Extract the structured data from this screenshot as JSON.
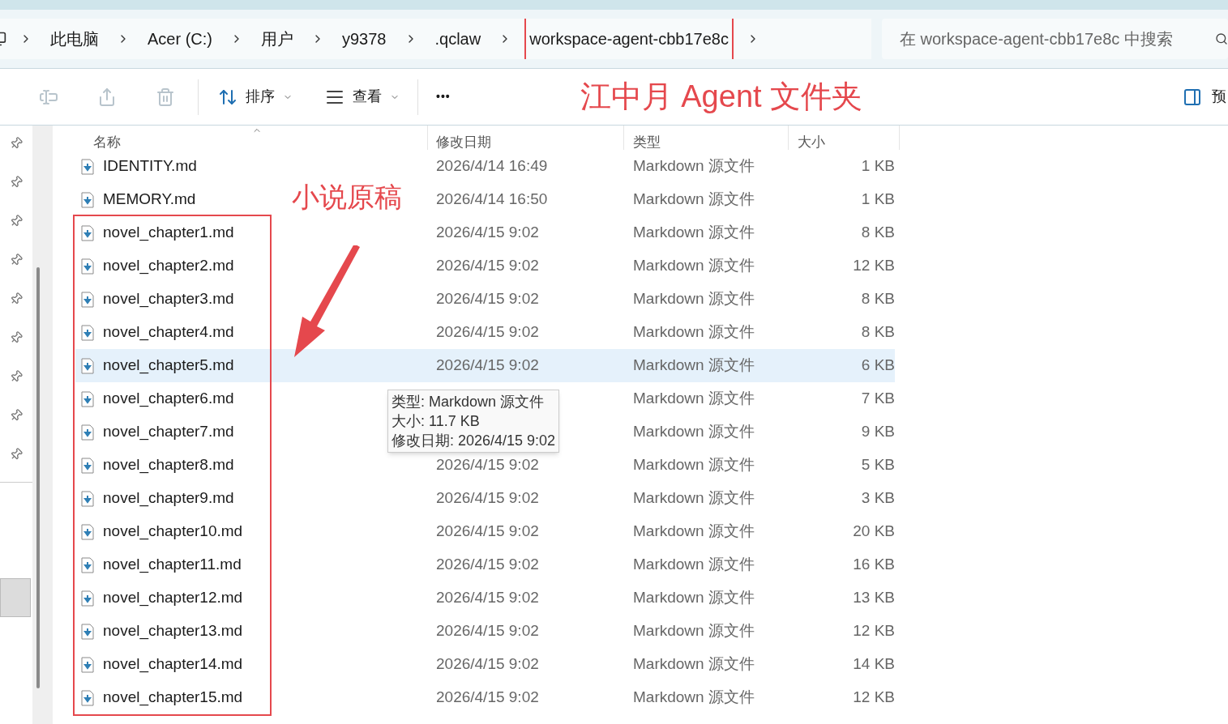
{
  "breadcrumb": {
    "items": [
      {
        "label": "此电脑",
        "selected": false
      },
      {
        "label": "Acer (C:)",
        "selected": false
      },
      {
        "label": "用户",
        "selected": false
      },
      {
        "label": "y9378",
        "selected": false
      },
      {
        "label": ".qclaw",
        "selected": false
      },
      {
        "label": "workspace-agent-cbb17e8c",
        "selected": true
      }
    ]
  },
  "search": {
    "placeholder": "在 workspace-agent-cbb17e8c 中搜索"
  },
  "toolbar": {
    "sort": "排序",
    "view": "查看",
    "more": "•••",
    "preview": "预"
  },
  "annotations": {
    "folder_label": "江中月 Agent 文件夹",
    "drafts_label": "小说原稿"
  },
  "table": {
    "columns": [
      "名称",
      "修改日期",
      "类型",
      "大小"
    ],
    "rows": [
      {
        "name": "IDENTITY.md",
        "date": "2026/4/14 16:49",
        "type": "Markdown 源文件",
        "size": "1 KB",
        "selected": false
      },
      {
        "name": "MEMORY.md",
        "date": "2026/4/14 16:50",
        "type": "Markdown 源文件",
        "size": "1 KB",
        "selected": false
      }
    ],
    "framed_rows": [
      {
        "name": "novel_chapter1.md",
        "date": "2026/4/15 9:02",
        "type": "Markdown 源文件",
        "size": "8 KB",
        "selected": false
      },
      {
        "name": "novel_chapter2.md",
        "date": "2026/4/15 9:02",
        "type": "Markdown 源文件",
        "size": "12 KB",
        "selected": false
      },
      {
        "name": "novel_chapter3.md",
        "date": "2026/4/15 9:02",
        "type": "Markdown 源文件",
        "size": "8 KB",
        "selected": false
      },
      {
        "name": "novel_chapter4.md",
        "date": "2026/4/15 9:02",
        "type": "Markdown 源文件",
        "size": "8 KB",
        "selected": false
      },
      {
        "name": "novel_chapter5.md",
        "date": "2026/4/15 9:02",
        "type": "Markdown 源文件",
        "size": "6 KB",
        "selected": true
      },
      {
        "name": "novel_chapter6.md",
        "type": "Markdown 源文件",
        "size": "7 KB",
        "selected": false
      },
      {
        "name": "novel_chapter7.md",
        "type": "Markdown 源文件",
        "size": "9 KB",
        "selected": false
      },
      {
        "name": "novel_chapter8.md",
        "date": "2026/4/15 9:02",
        "type": "Markdown 源文件",
        "size": "5 KB",
        "selected": false
      },
      {
        "name": "novel_chapter9.md",
        "date": "2026/4/15 9:02",
        "type": "Markdown 源文件",
        "size": "3 KB",
        "selected": false
      },
      {
        "name": "novel_chapter10.md",
        "date": "2026/4/15 9:02",
        "type": "Markdown 源文件",
        "size": "20 KB",
        "selected": false
      },
      {
        "name": "novel_chapter11.md",
        "date": "2026/4/15 9:02",
        "type": "Markdown 源文件",
        "size": "16 KB",
        "selected": false
      },
      {
        "name": "novel_chapter12.md",
        "date": "2026/4/15 9:02",
        "type": "Markdown 源文件",
        "size": "13 KB",
        "selected": false
      },
      {
        "name": "novel_chapter13.md",
        "date": "2026/4/15 9:02",
        "type": "Markdown 源文件",
        "size": "12 KB",
        "selected": false
      },
      {
        "name": "novel_chapter14.md",
        "date": "2026/4/15 9:02",
        "type": "Markdown 源文件",
        "size": "14 KB",
        "selected": false
      },
      {
        "name": "novel_chapter15.md",
        "date": "2026/4/15 9:02",
        "type": "Markdown 源文件",
        "size": "12 KB",
        "selected": false
      }
    ]
  },
  "tooltip": {
    "lines": [
      "类型: Markdown 源文件",
      "大小: 11.7 KB",
      "修改日期: 2026/4/15 9:02"
    ]
  }
}
